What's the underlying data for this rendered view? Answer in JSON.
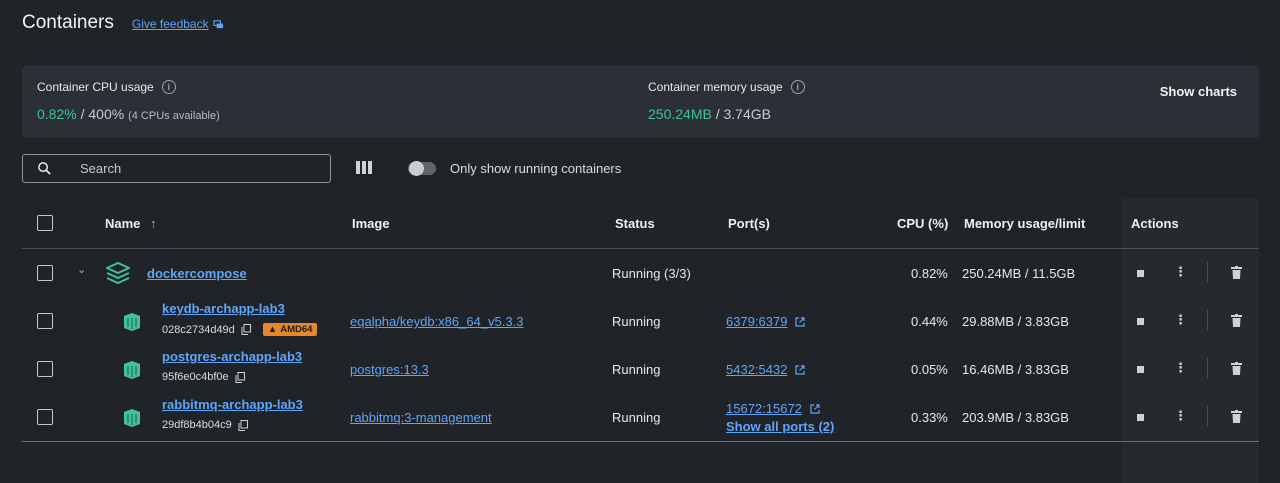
{
  "header": {
    "title": "Containers",
    "feedback": "Give feedback"
  },
  "stats": {
    "cpu_label": "Container CPU usage",
    "cpu_used": "0.82%",
    "cpu_sep": " / ",
    "cpu_total": "400%",
    "cpu_note": "(4 CPUs available)",
    "mem_label": "Container memory usage",
    "mem_used": "250.24MB",
    "mem_sep": " / ",
    "mem_total": "3.74GB",
    "show_charts": "Show charts"
  },
  "toolbar": {
    "search_placeholder": "Search",
    "toggle_label": "Only show running containers"
  },
  "table": {
    "columns": {
      "name": "Name",
      "image": "Image",
      "status": "Status",
      "ports": "Port(s)",
      "cpu": "CPU (%)",
      "memory": "Memory usage/limit",
      "actions": "Actions"
    },
    "group": {
      "name": "dockercompose",
      "status": "Running (3/3)",
      "cpu": "0.82%",
      "memory": "250.24MB / 11.5GB"
    },
    "rows": [
      {
        "name": "keydb-archapp-lab3",
        "id": "028c2734d49d",
        "badge": "AMD64",
        "image": "eqalpha/keydb:x86_64_v5.3.3",
        "status": "Running",
        "port": "6379:6379",
        "cpu": "0.44%",
        "memory": "29.88MB / 3.83GB"
      },
      {
        "name": "postgres-archapp-lab3",
        "id": "95f6e0c4bf0e",
        "image": "postgres:13.3",
        "status": "Running",
        "port": "5432:5432",
        "cpu": "0.05%",
        "memory": "16.46MB / 3.83GB"
      },
      {
        "name": "rabbitmq-archapp-lab3",
        "id": "29df8b4b04c9",
        "image": "rabbitmq:3-management",
        "status": "Running",
        "port": "15672:15672",
        "show_all": "Show all ports (2)",
        "cpu": "0.33%",
        "memory": "203.9MB / 3.83GB"
      }
    ]
  }
}
